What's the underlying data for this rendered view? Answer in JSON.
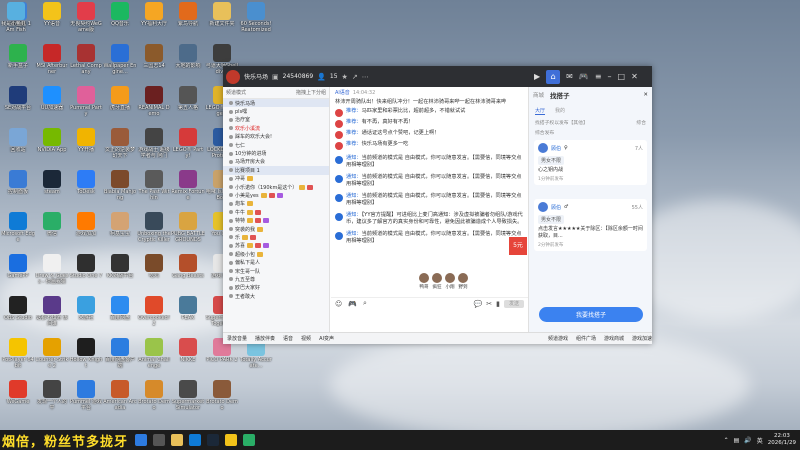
{
  "desktop_icons": [
    {
      "label": "此电脑",
      "color": "#3d7fd6"
    },
    {
      "label": "YY语音",
      "color": "#f3c31a"
    },
    {
      "label": "无畏契约WeGame版",
      "color": "#e23d4a"
    },
    {
      "label": "QQ音乐",
      "color": "#1bb860"
    },
    {
      "label": "YY福利大厅",
      "color": "#f5a623"
    },
    {
      "label": "紫鸟导航",
      "color": "#e26a1b"
    },
    {
      "label": "新建文件夹",
      "color": "#e8c05a"
    },
    {
      "label": "60 Seconds! Reatomized",
      "color": "#4a8fcf"
    },
    {
      "label": "我是小鱼儿 1 Am Fish",
      "color": "#58b0e0"
    },
    {
      "label": "新手盒子",
      "color": "#2db24d"
    },
    {
      "label": "MSI Afterburner",
      "color": "#c62828"
    },
    {
      "label": "Lethal Company",
      "color": "#a83232"
    },
    {
      "label": "Wallpaper Engine...",
      "color": "#2a6fd6"
    },
    {
      "label": "三国志14",
      "color": "#8b5a2b"
    },
    {
      "label": "大地的影响",
      "color": "#4d6b8a"
    },
    {
      "label": "弓道大师Shelldiver",
      "color": "#3d3d3d"
    },
    {
      "label": "SE对战平台",
      "color": "#1f3c7a"
    },
    {
      "label": "UU加速器",
      "color": "#1e90ff"
    },
    {
      "label": "Pummel Party",
      "color": "#e0609a"
    },
    {
      "label": "虎牙直播",
      "color": "#f59b1a"
    },
    {
      "label": "REANIMAL Demo",
      "color": "#6b2020"
    },
    {
      "label": "第五人格",
      "color": "#555"
    },
    {
      "label": "LEGO® Voyagers",
      "color": "#e0b32a"
    },
    {
      "label": "回收站",
      "color": "#7aa6d6"
    },
    {
      "label": "NVIDIA App",
      "color": "#76b900"
    },
    {
      "label": "YY开播",
      "color": "#f1b400"
    },
    {
      "label": "文正的逆袭梦幻天下",
      "color": "#9a5b3a"
    },
    {
      "label": "游戏战士 超级学者与 阿门",
      "color": "#444"
    },
    {
      "label": "LEGO® Party!",
      "color": "#d63a3a"
    },
    {
      "label": "LOCKDOWN Protocol",
      "color": "#2b5aa0"
    },
    {
      "label": "控制面板",
      "color": "#3a7bd5"
    },
    {
      "label": "steam",
      "color": "#1b2838"
    },
    {
      "label": "ToDesk",
      "color": "#2d7cf6"
    },
    {
      "label": "Biabia Mahjong",
      "color": "#7c4a2b"
    },
    {
      "label": "The Past Within",
      "color": "#5a5a5a"
    },
    {
      "label": "Remix Fortune",
      "color": "#8a3a8a"
    },
    {
      "label": "咆哮 Island & Bots",
      "color": "#c9a26a"
    },
    {
      "label": "Microsoft Edge",
      "color": "#0f7bd6"
    },
    {
      "label": "微信",
      "color": "#2aae67"
    },
    {
      "label": "游戏加加",
      "color": "#ff7a00"
    },
    {
      "label": "柯基宝宝",
      "color": "#d4a373"
    },
    {
      "label": "Unboxing the Cryptic Killer",
      "color": "#394a5a"
    },
    {
      "label": "PUBG BATTLEGROUNDS",
      "color": "#d9a441"
    },
    {
      "label": "You Quiz",
      "color": "#e6c229"
    },
    {
      "label": "GamePP",
      "color": "#1a6ee0"
    },
    {
      "label": "Draw & Guess - 你画我猜",
      "color": "#f0f0f0"
    },
    {
      "label": "Studio One 7",
      "color": "#2f2f2f"
    },
    {
      "label": "KK对战平台",
      "color": "#333"
    },
    {
      "label": "吃鸡",
      "color": "#7a4b2a"
    },
    {
      "label": "Gang Beasts",
      "color": "#b44f2a"
    },
    {
      "label": "游戏 好友",
      "color": "#e6e6e6"
    },
    {
      "label": "OBS Studio",
      "color": "#222"
    },
    {
      "label": "这都不知道 该问谁",
      "color": "#5a3a8a"
    },
    {
      "label": "米游社",
      "color": "#3aa0e0"
    },
    {
      "label": "百度网盘",
      "color": "#2d8cf0"
    },
    {
      "label": "Overcooked! 2",
      "color": "#e04a2a"
    },
    {
      "label": "PEAK",
      "color": "#4a7a9a"
    },
    {
      "label": "Supermarket Together",
      "color": "#d64a4a"
    },
    {
      "label": "PotPlayer 64 bit",
      "color": "#f5c400"
    },
    {
      "label": "Counter-Strike 2",
      "color": "#e5a100"
    },
    {
      "label": "Hollow Knight",
      "color": "#1e1e1e"
    },
    {
      "label": "百度网盘客户端",
      "color": "#2b7de0"
    },
    {
      "label": "Animal Challenge",
      "color": "#9ac44a"
    },
    {
      "label": "NIKKE",
      "color": "#d94d4d"
    },
    {
      "label": "PICO PARK 2",
      "color": "#e07a9a"
    },
    {
      "label": "Totally Accurate...",
      "color": "#7ac4e0"
    },
    {
      "label": "WeGame",
      "color": "#e03a2a"
    },
    {
      "label": "发现一个人的平",
      "color": "#444"
    },
    {
      "label": "Pummel 游戏平台",
      "color": "#2d7be0"
    },
    {
      "label": "American Arcadia",
      "color": "#c75a2a"
    },
    {
      "label": "Brotato Demo",
      "color": "#d68a2a"
    },
    {
      "label": "Supermarket Simulator",
      "color": "#4a4a4a"
    },
    {
      "label": "Brotato Demo",
      "color": "#8a5a3a"
    }
  ],
  "window": {
    "title": "快乐马场",
    "room_id": "24540869",
    "online": "15",
    "sidebar": {
      "header_left": "频道模式",
      "header_right": "拖拽上下分组",
      "rows": [
        {
          "t": "快乐马场",
          "c": "sel"
        },
        {
          "t": "pls嘿",
          "c": ""
        },
        {
          "t": "治疗室",
          "c": ""
        },
        {
          "t": "欢乐小溪流",
          "c": "red"
        },
        {
          "t": "踩车的欢乐大会!",
          "c": ""
        },
        {
          "t": "七仁",
          "c": ""
        },
        {
          "t": "10分钟的进场",
          "c": ""
        },
        {
          "t": "马场开房大会",
          "c": ""
        },
        {
          "t": "比赛项目 1",
          "c": "sel"
        },
        {
          "t": "冲哥",
          "c": ""
        },
        {
          "t": "小乐诺你（190km是这个）",
          "c": ""
        },
        {
          "t": "小美是yes",
          "c": ""
        },
        {
          "t": "炮车",
          "c": ""
        },
        {
          "t": "牛牛",
          "c": ""
        },
        {
          "t": "特特",
          "c": ""
        },
        {
          "t": "突袭的我",
          "c": ""
        },
        {
          "t": "乐",
          "c": ""
        },
        {
          "t": "苏喜",
          "c": ""
        },
        {
          "t": "超级小包",
          "c": ""
        },
        {
          "t": "偏私下是人",
          "c": ""
        },
        {
          "t": "宋生哥一队",
          "c": ""
        },
        {
          "t": "九五至尊",
          "c": ""
        },
        {
          "t": "欧巴大家好",
          "c": ""
        },
        {
          "t": "王者敢大",
          "c": ""
        }
      ]
    },
    "chat": {
      "label": "Al语音",
      "time": "14:04:32",
      "messages": [
        {
          "kind": "plain",
          "text": "林沛开周骑队出！快来组队冲分！一起在林沛骑哥来哔一起在林沛骑哥来哔"
        },
        {
          "kind": "notice",
          "head": "推荐：",
          "text": "马匹家里和彩票比比，超前超多，不错就试试"
        },
        {
          "kind": "notice",
          "head": "推荐：",
          "text": "有不再，真好有不再！"
        },
        {
          "kind": "notice",
          "head": "推荐：",
          "text": "通话证这号点个赞吧，记更上啊！"
        },
        {
          "kind": "notice",
          "head": "推荐：",
          "text": "快乐马场有更多一吃"
        },
        {
          "kind": "notice",
          "head": "通知：",
          "text": "当前频道的模式是 自由模式，你可以随意发言。【需要信，同境等交点用相等理别】"
        },
        {
          "kind": "notice",
          "head": "通知：",
          "text": "当前频道的模式是 自由模式，你可以随意发言。【需要信，同境等交点用相等理别】"
        },
        {
          "kind": "notice",
          "head": "通知：",
          "text": "当前频道的模式是 自由模式，你可以随意发言。【需要信，同境等交点用相等理别】"
        },
        {
          "kind": "notice",
          "head": "通知：",
          "text": "【YY官方提醒】可进组比上麦门高通知：涉及虚拟被骗者勿组队/游戏代币，建议多了解官方的真实身份和可靠性，避免因此被骗造成个人导致损失。"
        },
        {
          "kind": "notice",
          "head": "通知：",
          "text": "当前频道的模式是 自由模式，你可以随意发言。【需要信，同境等交点用相等理别】"
        }
      ],
      "banner": "5元",
      "users": [
        "鸭哥",
        "疯狂",
        "小翔",
        "野到"
      ],
      "send": "发送"
    },
    "bottom": [
      "录放音量",
      "播放伴奏",
      "语音",
      "视频",
      "AI变声",
      "频道游戏",
      "组件广场",
      "游戏商城",
      "游戏加速"
    ],
    "panel": {
      "title": "找搭子",
      "tab_main": "大厅",
      "tab_other": "我的",
      "search": "找搭子权以发布【其他】",
      "sort": "综合",
      "pub": "综合发布",
      "cards": [
        {
          "name": "顾伯",
          "badge": "♀",
          "count": "7人",
          "tag": "男女不限",
          "text": "心之钥内战",
          "foot": "1分钟前发布"
        },
        {
          "name": "顾伯",
          "badge": "♂",
          "count": "55人",
          "tag": "男女不限",
          "text": "点击发言★★★★★关于除区：【除区余额一时间获取，目...",
          "foot": "2分钟前发布"
        }
      ],
      "find_button": "我要找搭子"
    }
  },
  "taskbar": {
    "banner": "烟倍，粉丝节多拢牙",
    "time": "22:03",
    "date": "2026/1/29",
    "ime": "英"
  }
}
